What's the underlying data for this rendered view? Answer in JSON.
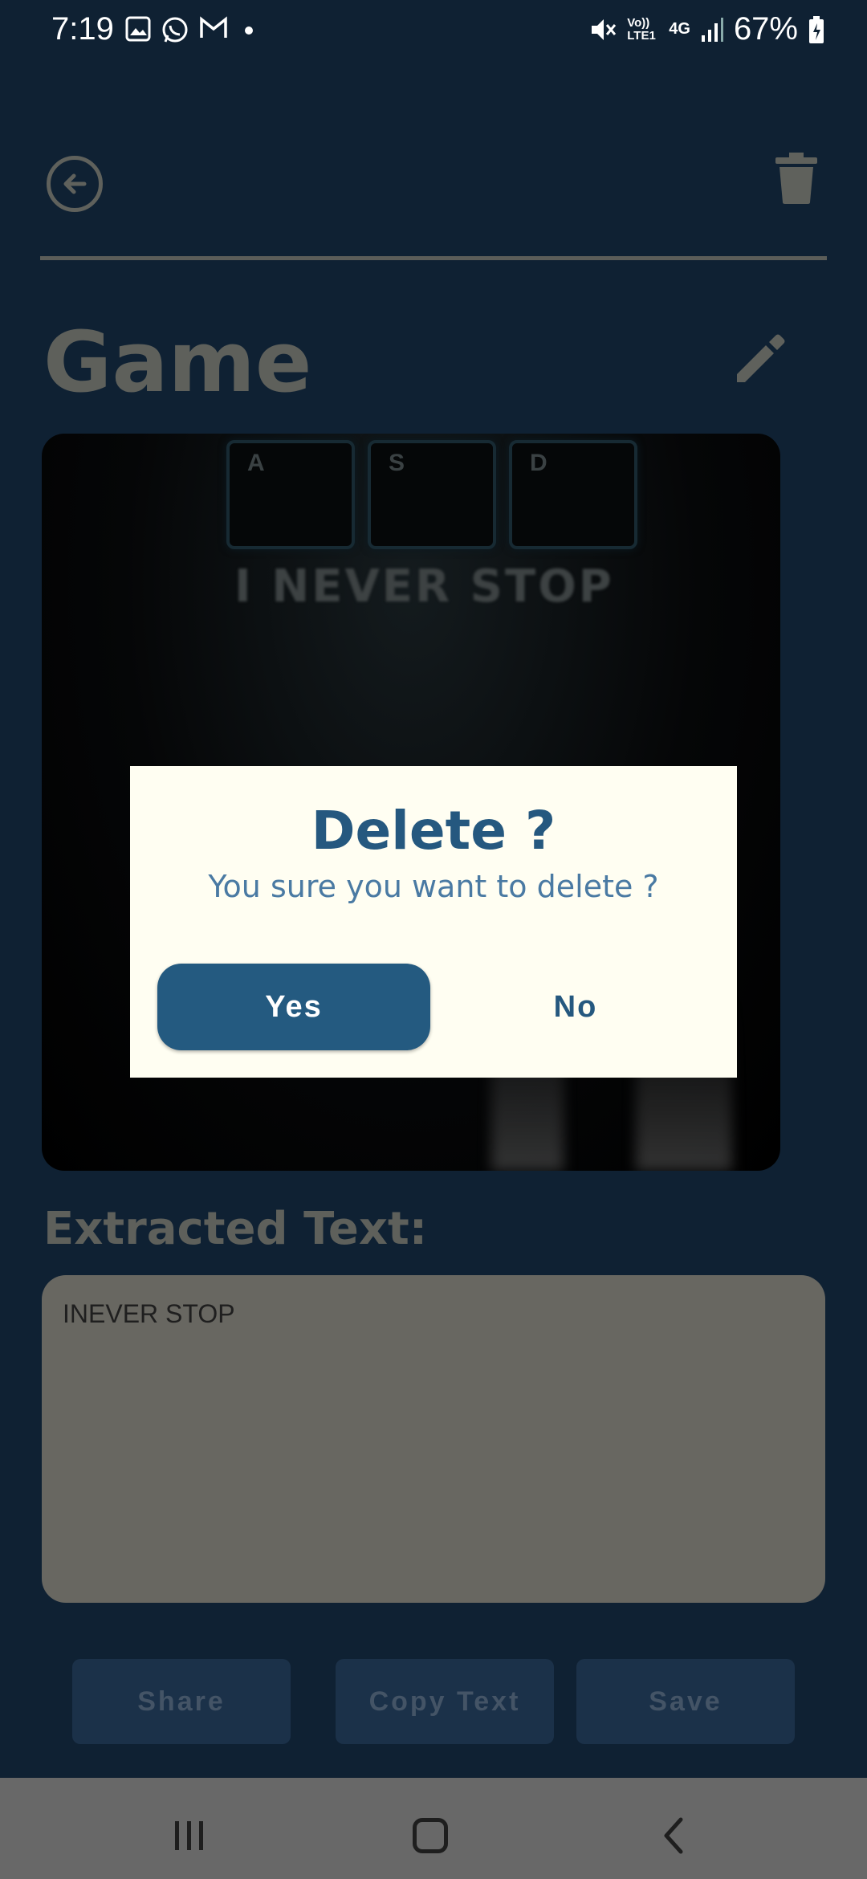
{
  "status_bar": {
    "time": "7:19",
    "battery": "67%",
    "network": "4G",
    "volte": "Vo)) LTE1",
    "icons": [
      "gallery-icon",
      "whatsapp-icon",
      "gmail-icon",
      "dot-icon",
      "mute-icon",
      "signal-icon",
      "battery-icon"
    ]
  },
  "header": {
    "back_icon": "back-arrow-circle-icon",
    "delete_icon": "trash-icon"
  },
  "note": {
    "title": "Game",
    "edit_icon": "pencil-icon",
    "image_text": "I NEVER STOP",
    "image_keys": [
      "A",
      "S",
      "D"
    ]
  },
  "extracted": {
    "label": "Extracted Text:",
    "value": "INEVER STOP"
  },
  "actions": {
    "share": "Share",
    "copy": "Copy Text",
    "save": "Save"
  },
  "dialog": {
    "title": "Delete ?",
    "message": "You sure you want to delete ?",
    "yes": "Yes",
    "no": "No"
  },
  "nav": {
    "icons": [
      "recents-icon",
      "home-icon",
      "back-icon"
    ]
  },
  "colors": {
    "background": "#0f2133",
    "dialog_bg": "#fffef2",
    "primary": "#245a80",
    "scrim_text": "#5e605b"
  }
}
